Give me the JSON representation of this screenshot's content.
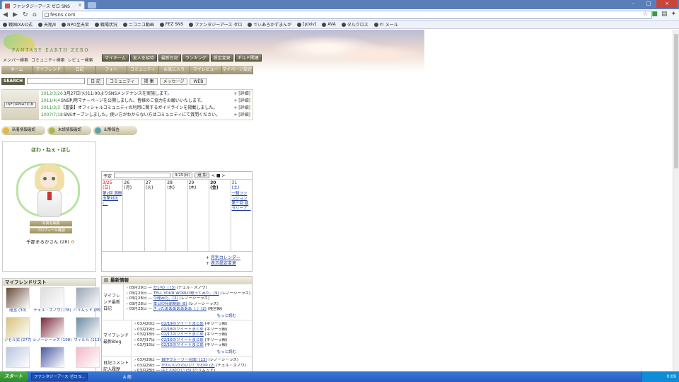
{
  "browser": {
    "tab_title": "ファンタジーアース ゼロ SNS",
    "url": "fesns.com",
    "bookmarks": [
      "戦国IXA公式",
      "天翔/Ⅱ",
      "NPO至天宮",
      "戦場状況",
      "ニコニコ動画",
      "FEZ SNS",
      "ファンタジーアース ゼロ",
      "でぃあろかずまんが",
      "[pixiv]",
      "AVA",
      "タルクロス",
      "Y! メール"
    ]
  },
  "site": {
    "logo_text": "FANTASY EARTH ZERO",
    "sublinks": [
      "メンバー検索",
      "コミュニティ検索",
      "レビュー検索"
    ],
    "topnav": [
      "マイホーム",
      "友人を招待",
      "最新日記",
      "ランキング",
      "設定変更",
      "ギルド関連"
    ],
    "mainnav": [
      "ホーム",
      "マイフレンド",
      "日記",
      "フォト",
      "コミュニティ",
      "お気に入り",
      "マイレビュー",
      "マイページ設定"
    ],
    "search": {
      "label": "SEARCH",
      "buttons": [
        "日 記",
        "コミュニティ",
        "掲 集",
        "メッセージ",
        "WEB"
      ]
    },
    "info": {
      "label": "INFORMATION",
      "more": "詳細",
      "items": [
        {
          "date": "2012/3/26",
          "text": " 3月27日(火)11:00よりSNSメンテナンスを実施します。"
        },
        {
          "date": "2011/4/4",
          "text": " SNS利用マナーページを公開しました。皆様のご協力をお願いいたします。"
        },
        {
          "date": "2011/3/3",
          "text": " 【重要】オフィシャルコミュニティの利用に関するガイドラインを掲載しました。"
        },
        {
          "date": "2007/7/18",
          "text": " SNSオープンしました。使い方がわからない方はコミュニティにて質問ください。"
        }
      ]
    },
    "status_buttons": [
      "新着情報確認",
      "未読情報確認",
      "出撃報告"
    ],
    "profile": {
      "title": "ほわ・ねぇ・ほし",
      "btn1": "写真を編集",
      "btn2": "プロフィール確認",
      "name": "千那まるかさん (28)"
    },
    "friends": {
      "title": "マイフレンドリスト",
      "items": [
        {
          "name": "隆宮 (30)",
          "color": "#6a4a3a"
        },
        {
          "name": "チェル・スノウ/ (78)",
          "color": "#dcdcdc"
        },
        {
          "name": "ハリムッド (85)",
          "color": "#9aa4b4"
        },
        {
          "name": "ジゼル式 (277)",
          "color": "#d9c27a"
        },
        {
          "name": "レノーシーラス (108)",
          "color": "#7a2a3a"
        },
        {
          "name": "ウィルル (113)",
          "color": "#6a8aa4"
        },
        {
          "name": "",
          "color": "#b8c4e0"
        },
        {
          "name": "",
          "color": "#4a5aa0"
        },
        {
          "name": "",
          "color": "#f2b8c8"
        }
      ]
    },
    "calendar": {
      "label": "予定",
      "select": "3/25(日)",
      "add": "追 加",
      "nav": "< ■ >",
      "days": [
        {
          "num": "3/25",
          "dow": "(日)",
          "cls": "sun",
          "ev": "第2回 週間出撃対抗(..."
        },
        {
          "num": "26",
          "dow": "(月)",
          "cls": "",
          "ev": ""
        },
        {
          "num": "27",
          "dow": "(火)",
          "cls": "",
          "ev": ""
        },
        {
          "num": "28",
          "dow": "(水)",
          "cls": "",
          "ev": ""
        },
        {
          "num": "29",
          "dow": "(木)",
          "cls": "",
          "ev": ""
        },
        {
          "num": "30",
          "dow": "(金)",
          "cls": "today",
          "ev": ""
        },
        {
          "num": "31",
          "dow": "(土)",
          "cls": "sat",
          "ev": "一騎ファンション 第三回 週ラリーア..."
        }
      ],
      "link1": "月別カレンダー",
      "link2": "表示設定変更"
    },
    "latest": {
      "title": "最新情報",
      "sections": [
        {
          "label": "マイフレンド最新日記",
          "items": [
            {
              "date": "03月29日 — ",
              "link": "かいの（ (3)",
              "tail": " (チェル・スノウ)"
            },
            {
              "date": "03月29日 — ",
              "link": "TELL YOUR WORLD歌ってみた。(9)",
              "tail": " (レノーシーラス)"
            },
            {
              "date": "03月28日 — ",
              "link": "今閲みだ。(2)",
              "tail": " (レノーシーラス)"
            },
            {
              "date": "03月28日 — ",
              "link": "本日の持原制前 (8)",
              "tail": " (レノーシーラス)"
            },
            {
              "date": "03月28日 — ",
              "link": "ぎったあああああああ（ ）(2)",
              "tail": " (隆宮殿)"
            }
          ],
          "more": "もっと読む"
        },
        {
          "label": "マイフレンド最新Blog",
          "items": [
            {
              "date": "03月20日 — ",
              "link": "02/19のツイートまとめ",
              "tail": " (ネリーラ殿)"
            },
            {
              "date": "03月19日 — ",
              "link": "02/18のツイートまとめ",
              "tail": " (ネリーラ殿)"
            },
            {
              "date": "03月18日 — ",
              "link": "02/17のツイートまとめ",
              "tail": " (ネリーラ殿)"
            },
            {
              "date": "03月17日 — ",
              "link": "02/16のツイートまとめ",
              "tail": " (ネリーラ殿)"
            },
            {
              "date": "03月15日 — ",
              "link": "02/15のツイートまとめ",
              "tail": " (ネリーラ殿)"
            }
          ],
          "more": "もっと読む"
        },
        {
          "label": "日記コメント記入履歴",
          "items": [
            {
              "date": "03月29日 — ",
              "link": "自作ウォーリー完成! (13)",
              "tail": " (レノーシーラス)"
            },
            {
              "date": "03月29日 — ",
              "link": "かわいいかわいい！かわゆ (2)",
              "tail": " (チェル・スノウ)"
            },
            {
              "date": "03月28日 — ",
              "link": "はとわゆかい (5)",
              "tail": " (ハリムッド)"
            }
          ],
          "more": ""
        }
      ]
    }
  },
  "taskbar": {
    "start": "スタート",
    "task": "ファンタジーアース ゼロ S...",
    "ime": "A 般",
    "clock": "0:09"
  }
}
